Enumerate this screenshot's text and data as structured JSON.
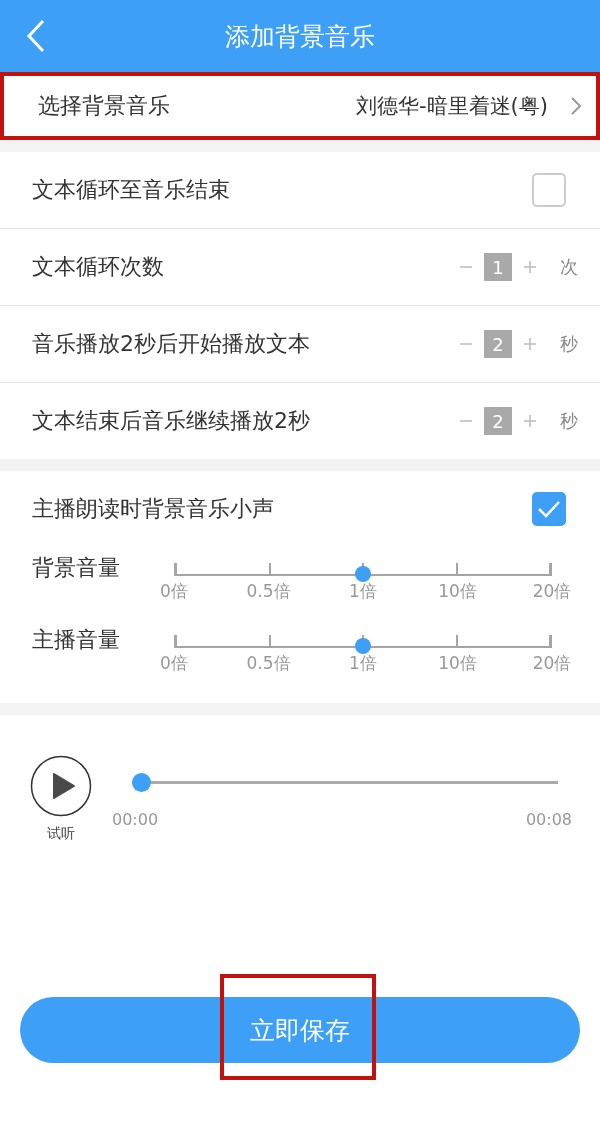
{
  "header": {
    "title": "添加背景音乐"
  },
  "music": {
    "label": "选择背景音乐",
    "value": "刘德华-暗里着迷(粤)",
    "highlighted": true
  },
  "loop": {
    "label": "文本循环至音乐结束",
    "checked": false
  },
  "steppers": [
    {
      "label": "文本循环次数",
      "value": "1",
      "unit": "次"
    },
    {
      "label": "音乐播放2秒后开始播放文本",
      "value": "2",
      "unit": "秒"
    },
    {
      "label": "文本结束后音乐继续播放2秒",
      "value": "2",
      "unit": "秒"
    }
  ],
  "duck": {
    "label": "主播朗读时背景音乐小声",
    "checked": true
  },
  "volumes": [
    {
      "label": "背景音量",
      "level": 0.5,
      "ticks": [
        "0倍",
        "0.5倍",
        "1倍",
        "10倍",
        "20倍"
      ]
    },
    {
      "label": "主播音量",
      "level": 0.5,
      "ticks": [
        "0倍",
        "0.5倍",
        "1倍",
        "10倍",
        "20倍"
      ]
    }
  ],
  "player": {
    "button_label": "试听",
    "level": 0,
    "start": "00:00",
    "end": "00:08"
  },
  "save": {
    "label": "立即保存",
    "highlighted": true
  }
}
